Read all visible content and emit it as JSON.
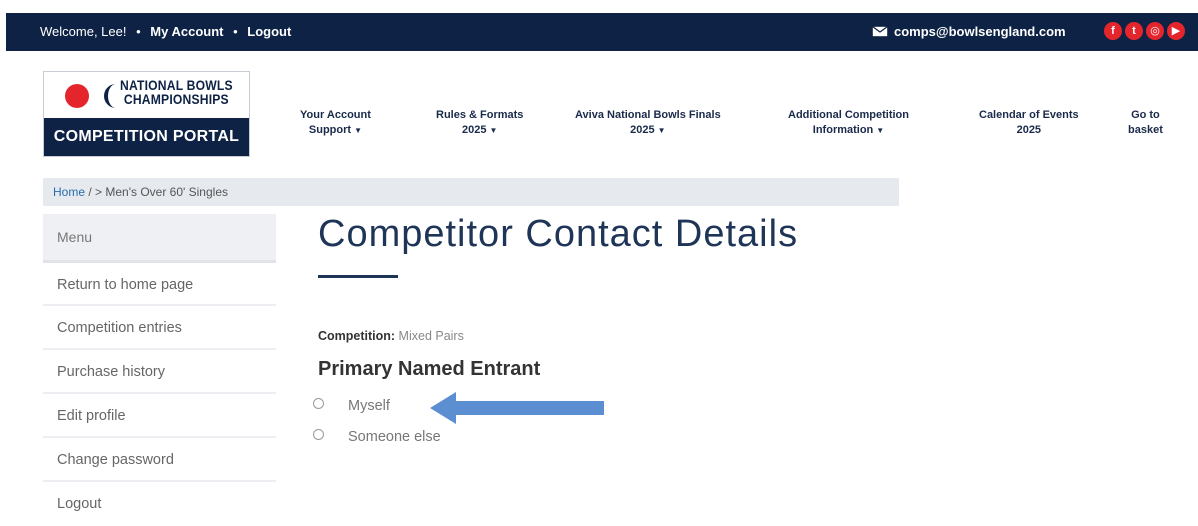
{
  "topbar": {
    "welcome": "Welcome, Lee!",
    "sep": "•",
    "my_account": "My Account",
    "logout": "Logout",
    "email": "comps@bowlsengland.com",
    "social": [
      {
        "name": "facebook-icon",
        "glyph": "f"
      },
      {
        "name": "twitter-icon",
        "glyph": "t"
      },
      {
        "name": "instagram-icon",
        "glyph": "◎"
      },
      {
        "name": "youtube-icon",
        "glyph": "▶"
      }
    ]
  },
  "logo": {
    "line1": "NATIONAL BOWLS",
    "line2": "CHAMPIONSHIPS",
    "portal": "COMPETITION PORTAL",
    "colors": {
      "red": "#e4262c",
      "navy": "#0d2244"
    }
  },
  "nav": [
    {
      "line1": "Your Account",
      "line2": "Support",
      "caret": true
    },
    {
      "line1": "Rules & Formats",
      "line2": "2025",
      "caret": true
    },
    {
      "line1": "Aviva National Bowls Finals",
      "line2": "2025",
      "caret": true
    },
    {
      "line1": "Additional Competition",
      "line2": "Information",
      "caret": true
    },
    {
      "line1": "Calendar of Events",
      "line2": "2025",
      "caret": false
    },
    {
      "line1": "Go to",
      "line2": "basket",
      "caret": false
    }
  ],
  "breadcrumb": {
    "home": "Home",
    "rest": " / > Men's Over 60' Singles"
  },
  "sidebar": {
    "header": "Menu",
    "items": [
      {
        "label": "Return to home page"
      },
      {
        "label": "Competition entries"
      },
      {
        "label": "Purchase history"
      },
      {
        "label": "Edit profile"
      },
      {
        "label": "Change password"
      },
      {
        "label": "Logout"
      }
    ]
  },
  "main": {
    "title": "Competitor Contact Details",
    "competition_label": "Competition:",
    "competition_value": " Mixed Pairs",
    "section_title": "Primary Named Entrant",
    "options": [
      {
        "label": "Myself"
      },
      {
        "label": "Someone else"
      }
    ],
    "arrow_color": "#5b8fd1"
  }
}
